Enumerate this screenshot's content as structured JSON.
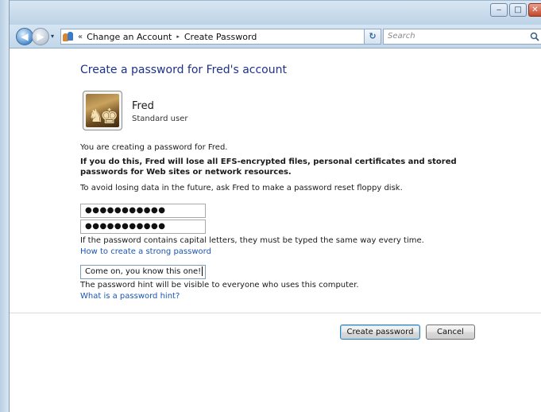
{
  "window": {
    "minimize_glyph": "‒",
    "maximize_glyph": "□",
    "close_glyph": "✕"
  },
  "address": {
    "overflow_chevron": "«",
    "crumbs": [
      "Change an Account",
      "Create Password"
    ],
    "separator": "▸",
    "dropdown": "▾",
    "refresh_glyph": "↻"
  },
  "search": {
    "placeholder": "Search"
  },
  "page": {
    "title": "Create a password for Fred's account",
    "user": {
      "name": "Fred",
      "type": "Standard user"
    },
    "intro": "You are creating a password for Fred.",
    "warning": "If you do this, Fred will lose all EFS-encrypted files, personal certificates and stored passwords for Web sites or network resources.",
    "advice": "To avoid losing data in the future, ask Fred to make a password reset floppy disk.",
    "password_mask": "●●●●●●●●●●●",
    "confirm_mask": "●●●●●●●●●●●",
    "case_note": "If the password contains capital letters, they must be typed the same way every time.",
    "strong_link": "How to create a strong password",
    "hint_value": "Come on, you know this one!",
    "hint_note": "The password hint will be visible to everyone who uses this computer.",
    "hint_link": "What is a password hint?"
  },
  "buttons": {
    "create": "Create password",
    "cancel": "Cancel"
  },
  "icons": {
    "back": "back-arrow-icon",
    "forward": "forward-arrow-icon",
    "user_accounts": "user-accounts-icon",
    "search": "search-icon",
    "avatar": "chess-pieces-avatar"
  },
  "colors": {
    "title": "#1e3287",
    "link": "#1a56b5",
    "window_chrome": "#c3d7ea",
    "close": "#c4462d"
  }
}
